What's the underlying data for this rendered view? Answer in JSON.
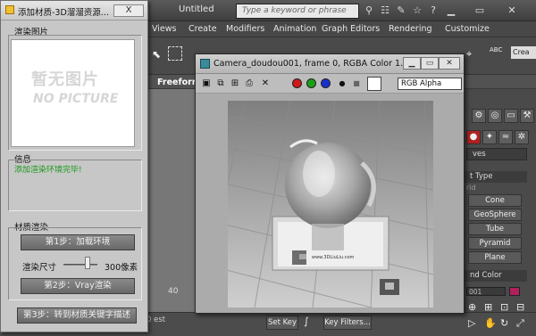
{
  "max": {
    "doc_title": "Untitled",
    "search_placeholder": "Type a keyword or phrase",
    "menus": [
      "Views",
      "Create",
      "Modifiers",
      "Animation",
      "Graph Editors",
      "Rendering",
      "Customize"
    ],
    "create_label": "Crea",
    "ribbon_tab": "Freeform",
    "cmd_dropdown": "ves",
    "rollout_object_type": "t Type",
    "autogrid": "rid",
    "primitives": [
      "Cone",
      "GeoSphere",
      "Tube",
      "Pyramid",
      "Plane"
    ],
    "rollout_name_color": "nd Color",
    "name_value": "001",
    "accent_color": "#b0205a",
    "timeline_number": "40",
    "status_left": "0",
    "status_left2": "est",
    "set_key": "Set Key",
    "key_filters": "Key Filters..."
  },
  "plugin": {
    "title": "添加材质-3D溜溜资源...",
    "close_label": "X",
    "group_render_image": "渲染图片",
    "nopic_main": "暂无图片",
    "nopic_sub": "NO PICTURE",
    "group_info": "信息",
    "info_text": "添加渲染环境完毕!",
    "group_material_render": "材质渲染",
    "step1": "第1步：加载环境",
    "size_label": "渲染尺寸",
    "size_value": "300像素",
    "size_level": 0.7,
    "step2": "第2步：Vray渲染",
    "step3": "第3步：转到材质关键字描述",
    "info_color": "#1a9a1a"
  },
  "render_window": {
    "title": "Camera_doudou001, frame 0, RGBA Color 1...",
    "channel_select": "RGB Alpha",
    "channel_colors": [
      "#d01818",
      "#18a018",
      "#1830d0"
    ],
    "stand_text": "www.3DLiuLiu.com"
  }
}
